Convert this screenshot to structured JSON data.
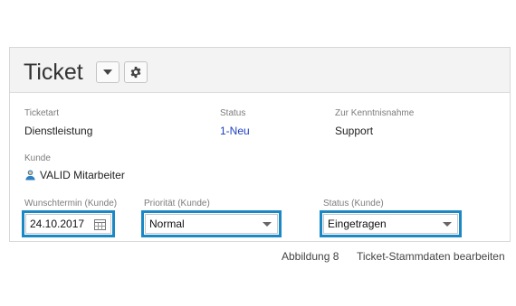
{
  "header": {
    "title": "Ticket",
    "dropdown_icon": "chevron-down-icon",
    "settings_icon": "gear-icon"
  },
  "fields": {
    "ticketart": {
      "label": "Ticketart",
      "value": "Dienstleistung"
    },
    "status": {
      "label": "Status",
      "value": "1-Neu"
    },
    "kenntnis": {
      "label": "Zur Kenntnisnahme",
      "value": "Support"
    },
    "kunde": {
      "label": "Kunde",
      "value": "VALID Mitarbeiter",
      "icon": "user-icon"
    },
    "wunschtermin": {
      "label": "Wunschtermin (Kunde)",
      "value": "24.10.2017",
      "icon": "calendar-icon"
    },
    "prioritaet": {
      "label": "Priorität (Kunde)",
      "value": "Normal"
    },
    "status_kunde": {
      "label": "Status (Kunde)",
      "value": "Eingetragen"
    }
  },
  "caption": {
    "figure": "Abbildung 8",
    "text": "Ticket-Stammdaten bearbeiten"
  },
  "colors": {
    "highlight": "#1b88c6",
    "link": "#1c3fc2",
    "header_bg": "#f3f3f3"
  }
}
